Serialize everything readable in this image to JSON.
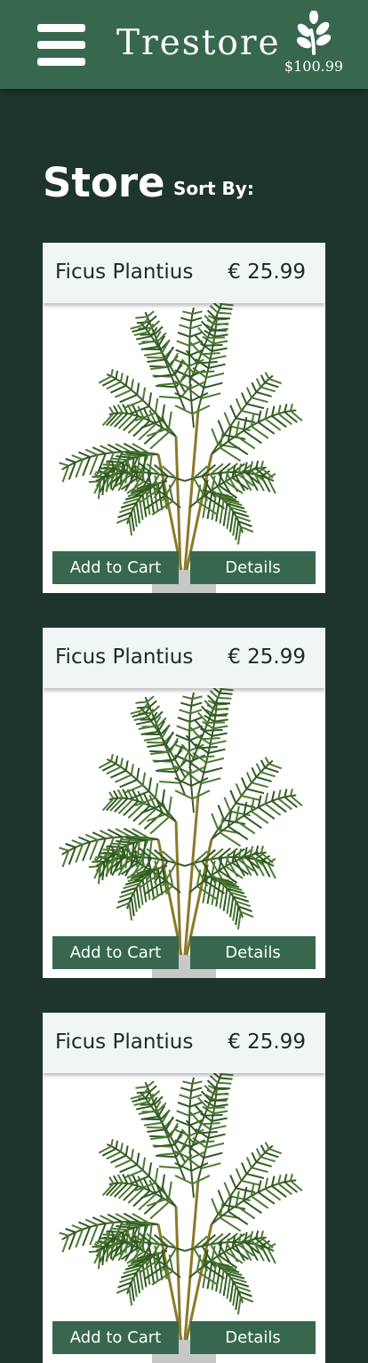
{
  "header": {
    "brand": "Trestore",
    "menu_icon": "hamburger-menu-icon",
    "cart_icon": "leaf-icon",
    "cart_total": "$100.99"
  },
  "page": {
    "title": "Store",
    "sort_label": "Sort By:"
  },
  "products": [
    {
      "name": "Ficus Plantius",
      "price": "€ 25.99",
      "add_label": "Add to Cart",
      "details_label": "Details",
      "image_icon": "palm-plant-image"
    },
    {
      "name": "Ficus Plantius",
      "price": "€ 25.99",
      "add_label": "Add to Cart",
      "details_label": "Details",
      "image_icon": "palm-plant-image"
    },
    {
      "name": "Ficus Plantius",
      "price": "€ 25.99",
      "add_label": "Add to Cart",
      "details_label": "Details",
      "image_icon": "palm-plant-image"
    }
  ],
  "colors": {
    "background": "#1e352d",
    "header": "#37684f",
    "button": "#37684f",
    "card_header": "#f0f6f5",
    "text_dark": "#1e2a26"
  }
}
